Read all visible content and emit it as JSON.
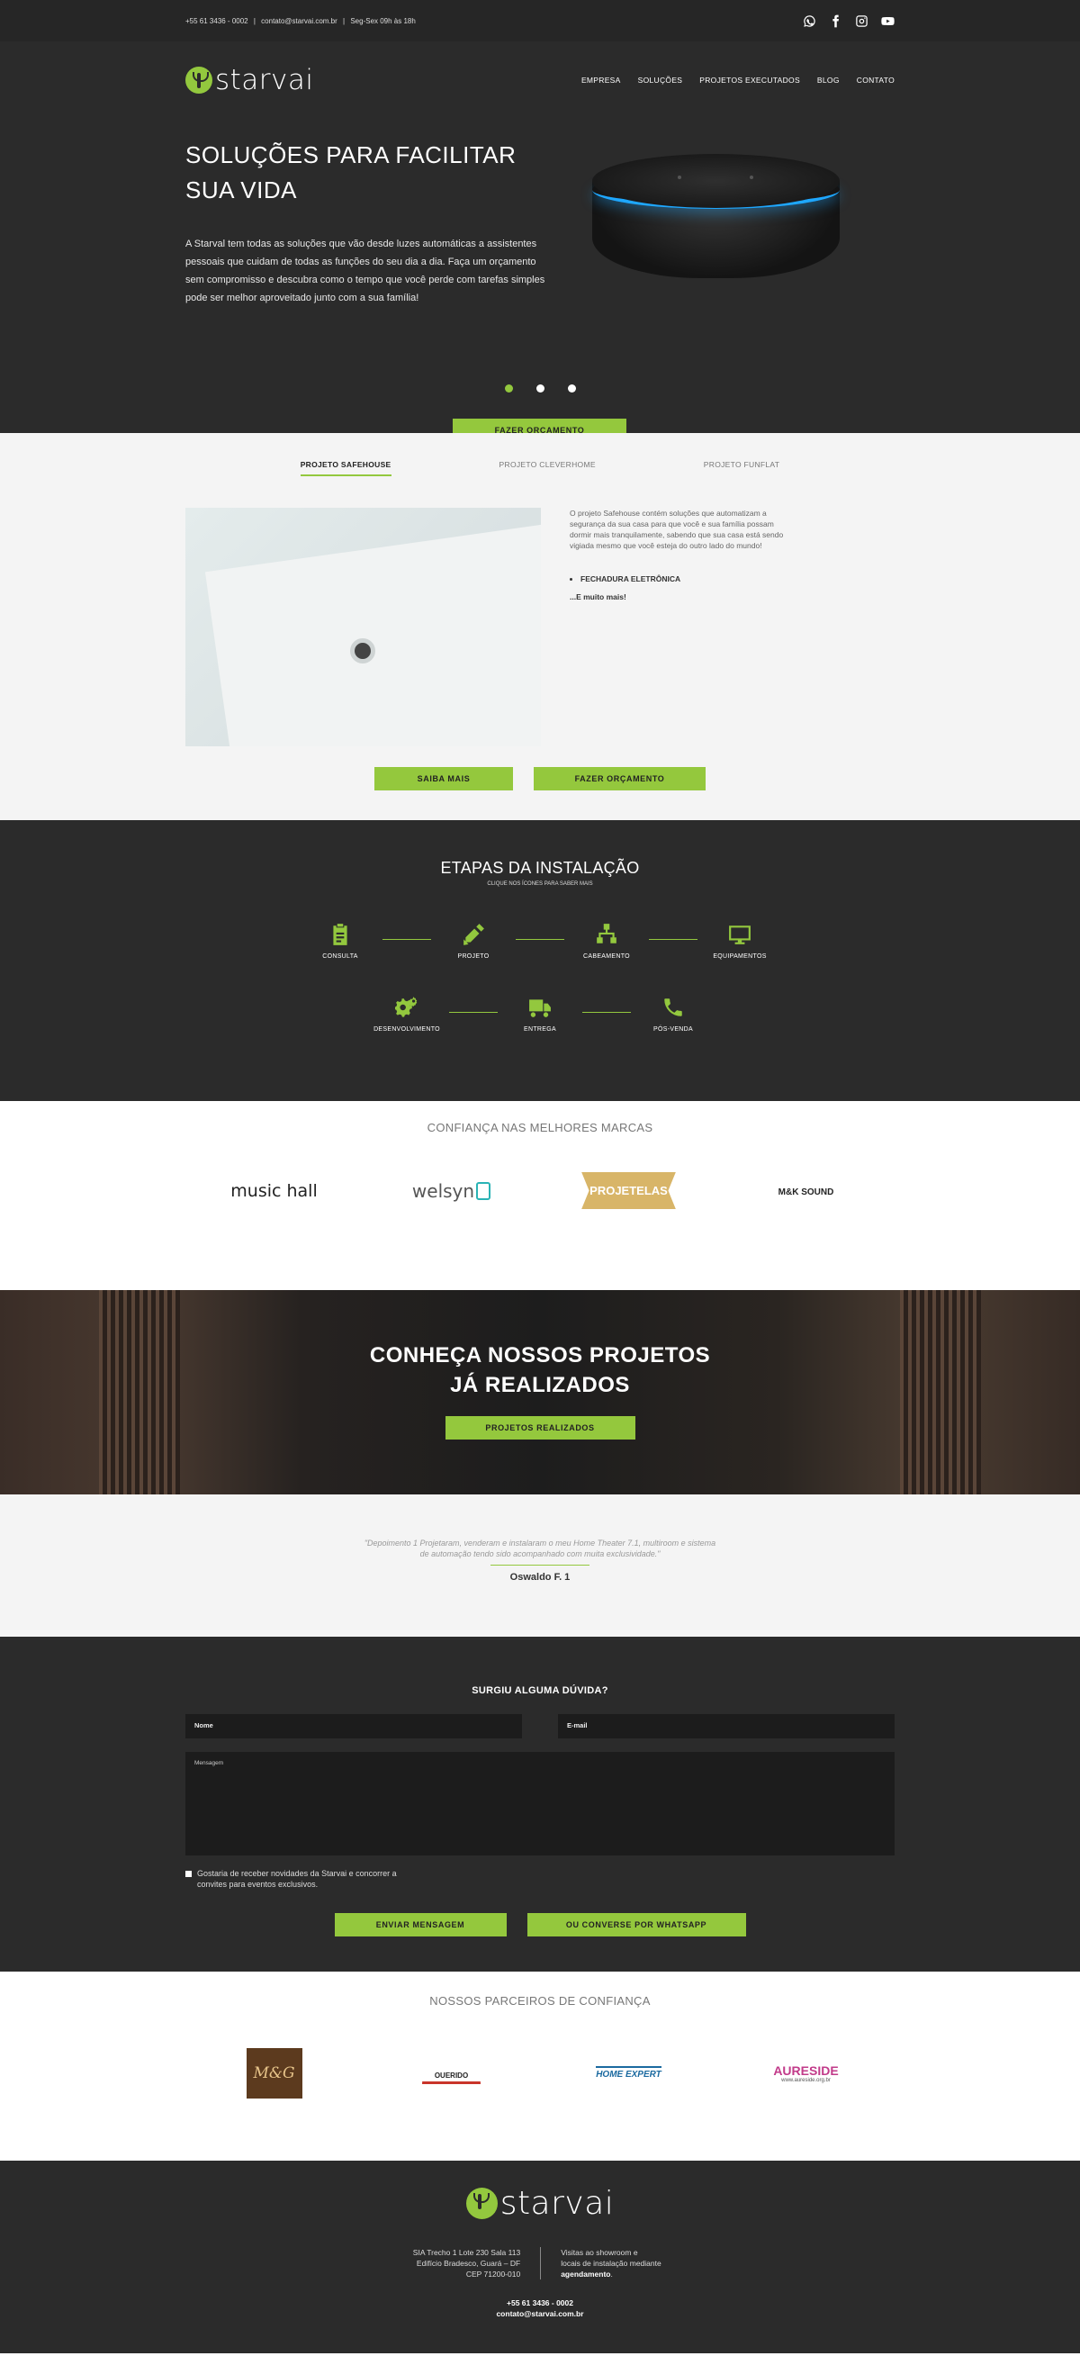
{
  "topbar": {
    "phone": "+55 61 3436 - 0002",
    "email": "contato@starvai.com.br",
    "hours": "Seg-Sex 09h às 18h",
    "sep": "|",
    "socials": [
      "whatsapp-icon",
      "facebook-icon",
      "instagram-icon",
      "youtube-icon"
    ]
  },
  "brand": {
    "name": "starvai",
    "accent": "#93c83e",
    "dark": "#2b2b2b"
  },
  "nav": {
    "items": [
      "EMPRESA",
      "SOLUÇÕES",
      "PROJETOS EXECUTADOS",
      "BLOG",
      "CONTATO"
    ]
  },
  "hero": {
    "title": "SOLUÇÕES PARA FACILITAR SUA VIDA",
    "text": "A Starval tem todas as soluções que vão desde luzes automáticas a assistentes pessoais que cuidam de todas as funções do seu dia a dia. Faça um orçamento sem compromisso e descubra como o tempo que você perde com tarefas simples pode ser melhor aproveitado junto com a sua família!",
    "cta": "FAZER ORÇAMENTO",
    "slides": 3,
    "active_slide": 1
  },
  "projects": {
    "tabs": [
      "PROJETO SAFEHOUSE",
      "PROJETO CLEVERHOME",
      "PROJETO FUNFLAT"
    ],
    "active_tab": 0,
    "description": "O projeto Safehouse contém soluções que automatizam a segurança da sua casa para que você e sua família possam dormir mais tranquilamente, sabendo que sua casa está sendo vigiada mesmo que você esteja do outro lado do mundo!",
    "features": [
      "FECHADURA ELETRÔNICA"
    ],
    "more": "...E muito mais!",
    "btn_more": "SAIBA MAIS",
    "btn_quote": "FAZER ORÇAMENTO"
  },
  "steps": {
    "title": "ETAPAS DA INSTALAÇÃO",
    "subtitle": "CLIQUE NOS ÍCONES PARA SABER MAIS",
    "row1": [
      {
        "label": "CONSULTA",
        "icon": "clipboard-icon"
      },
      {
        "label": "PROJETO",
        "icon": "pencil-ruler-icon"
      },
      {
        "label": "CABEAMENTO",
        "icon": "network-icon"
      },
      {
        "label": "EQUIPAMENTOS",
        "icon": "monitor-icon"
      }
    ],
    "row2": [
      {
        "label": "DESENVOLVIMENTO",
        "icon": "gears-icon"
      },
      {
        "label": "ENTREGA",
        "icon": "truck-icon"
      },
      {
        "label": "PÓS-VENDA",
        "icon": "phone-icon"
      }
    ]
  },
  "brands": {
    "title": "CONFIANÇA NAS MELHORES MARCAS",
    "items": [
      "music hall",
      "welsyn",
      "PROJETELAS",
      "M&K SOUND"
    ]
  },
  "banner": {
    "title_line1": "CONHEÇA NOSSOS PROJETOS",
    "title_line2": "JÁ REALIZADOS",
    "cta": "PROJETOS REALIZADOS"
  },
  "testimonial": {
    "quote": "\"Depoimento 1 Projetaram, venderam e instalaram o meu Home Theater 7.1, multiroom e sistema de automação tendo sido acompanhado com muita exclusividade.\"",
    "author": "Oswaldo F. 1"
  },
  "contact": {
    "title": "SURGIU ALGUMA DÚVIDA?",
    "name_placeholder": "Nome",
    "email_placeholder": "E-mail",
    "message_placeholder": "Mensagem",
    "newsletter": "Gostaria de receber novidades da Starvai e concorrer a convites para eventos exclusivos.",
    "btn_send": "ENVIAR MENSAGEM",
    "btn_whatsapp": "OU CONVERSE POR WHATSAPP"
  },
  "partners": {
    "title": "NOSSOS PARCEIROS DE CONFIANÇA",
    "items": [
      "M&G",
      "OUERIDO",
      "HOME EXPERT",
      "AURESIDE",
      "www.aureside.org.br"
    ]
  },
  "footer": {
    "addr1": "SIA Trecho 1 Lote 230 Sala 113",
    "addr2": "Edifício Bradesco, Guará – DF",
    "addr3": "CEP 71200-010",
    "visit1": "Visitas ao showroom e",
    "visit2": "locais de instalação mediante",
    "visit3": "agendamento",
    "visit_suffix": ".",
    "phone": "+55 61 3436 - 0002",
    "email": "contato@starvai.com.br"
  }
}
